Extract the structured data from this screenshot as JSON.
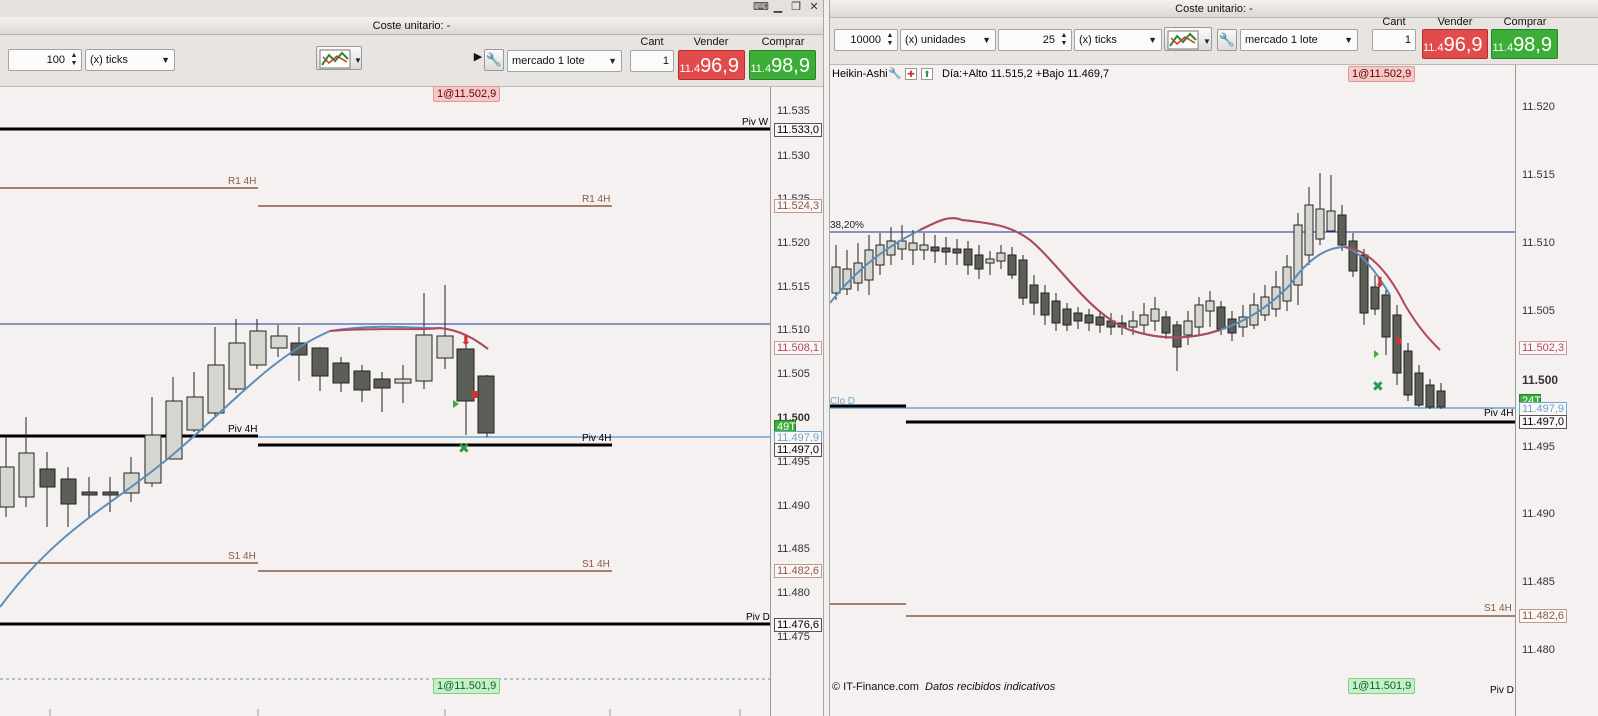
{
  "left": {
    "title": "Coste unitario: -",
    "titlebar_icons": [
      "keyboard-icon",
      "minimize-icon",
      "restore-icon",
      "close-icon"
    ],
    "ticks_value": "100",
    "ticks_unit": "(x) ticks",
    "order_type": "mercado 1 lote",
    "cant_label": "Cant",
    "cant_value": "1",
    "sell_label": "Vender",
    "buy_label": "Comprar",
    "sell_small": "11.4",
    "sell_big": "96,9",
    "buy_small": "11.4",
    "buy_big": "98,9",
    "order_top": "1@11.502,9",
    "order_bottom": "1@11.501,9",
    "y_ticks": [
      "11.535",
      "11.530",
      "11.525",
      "11.520",
      "11.515",
      "11.510",
      "11.505",
      "11.500",
      "11.495",
      "11.490",
      "11.485",
      "11.480",
      "11.475"
    ],
    "tags": {
      "piv_w": "11.533,0",
      "r1": "11.524,3",
      "ma": "11.508,1",
      "countdown": "49T",
      "price": "11.497,9",
      "piv4h": "11.497,0",
      "s1": "11.482,6",
      "piv_d": "11.476,6"
    },
    "levels": {
      "piv_w": "Piv W",
      "r1_a": "R1 4H",
      "r1_b": "R1 4H",
      "piv4h_a": "Piv 4H",
      "piv4h_b": "Piv 4H",
      "s1_a": "S1 4H",
      "s1_b": "S1 4H",
      "piv_d": "Piv D"
    }
  },
  "right": {
    "title": "Coste unitario: -",
    "qty_value": "10000",
    "qty_unit": "(x) unidades",
    "ticks_value": "25",
    "ticks_unit": "(x) ticks",
    "order_type": "mercado 1 lote",
    "cant_label": "Cant",
    "cant_value": "1",
    "sell_label": "Vender",
    "buy_label": "Comprar",
    "sell_small": "11.4",
    "sell_big": "96,9",
    "buy_small": "11.4",
    "buy_big": "98,9",
    "chart_label": "Heikin-Ashi",
    "day_info": "Día:+Alto 11.515,2 +Bajo 11.469,7",
    "fib_label": "38,20%",
    "clo_label": "Clo D",
    "order_top": "1@11.502,9",
    "order_bottom": "1@11.501,9",
    "copyright": "© IT-Finance.com",
    "disclaimer": "Datos recibidos indicativos",
    "y_ticks": [
      "11.520",
      "11.515",
      "11.510",
      "11.505",
      "11.500",
      "11.495",
      "11.490",
      "11.485",
      "11.480"
    ],
    "tags": {
      "ma": "11.502,3",
      "countdown": "24T",
      "price": "11.497,9",
      "piv4h": "11.497,0",
      "s1": "11.482,6"
    },
    "levels": {
      "piv4h": "Piv 4H",
      "s1": "S1 4H",
      "piv_d": "Piv D"
    }
  },
  "colors": {
    "sell": "#e24b4b",
    "buy": "#3cae38",
    "pivot": "#000000",
    "r1s1": "#8a5a44",
    "fib": "#1f2fa0",
    "ma_blue": "#5b8db8",
    "ma_red": "#b0485c",
    "price_line": "#6fa4cc"
  }
}
